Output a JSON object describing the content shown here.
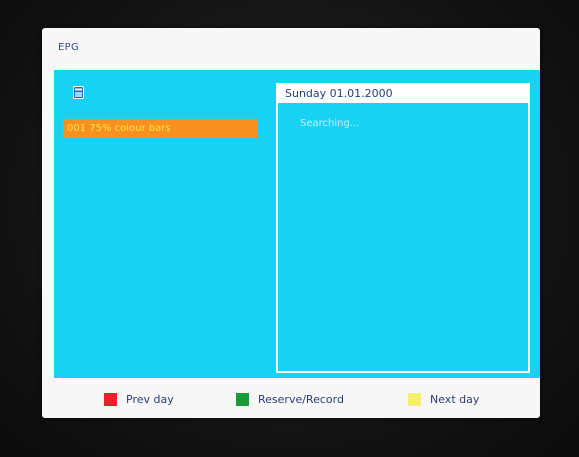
{
  "osd": {
    "title": "EPG"
  },
  "channel_list": {
    "items": [
      {
        "label": "001 75% colour bars",
        "selected": true
      }
    ],
    "icon": "tv-channel-icon"
  },
  "events": {
    "date": "Sunday 01.01.2000",
    "status": "Searching..."
  },
  "legend": {
    "prev_day": "Prev day",
    "reserve_record": "Reserve/Record",
    "next_day": "Next day"
  },
  "colors": {
    "panel_cyan": "#18d2f4",
    "highlight_orange": "#f7901e",
    "highlight_text": "#ffe34a",
    "key_red": "#e8202a",
    "key_green": "#1b9a3a",
    "key_yellow": "#f6ef6e"
  }
}
